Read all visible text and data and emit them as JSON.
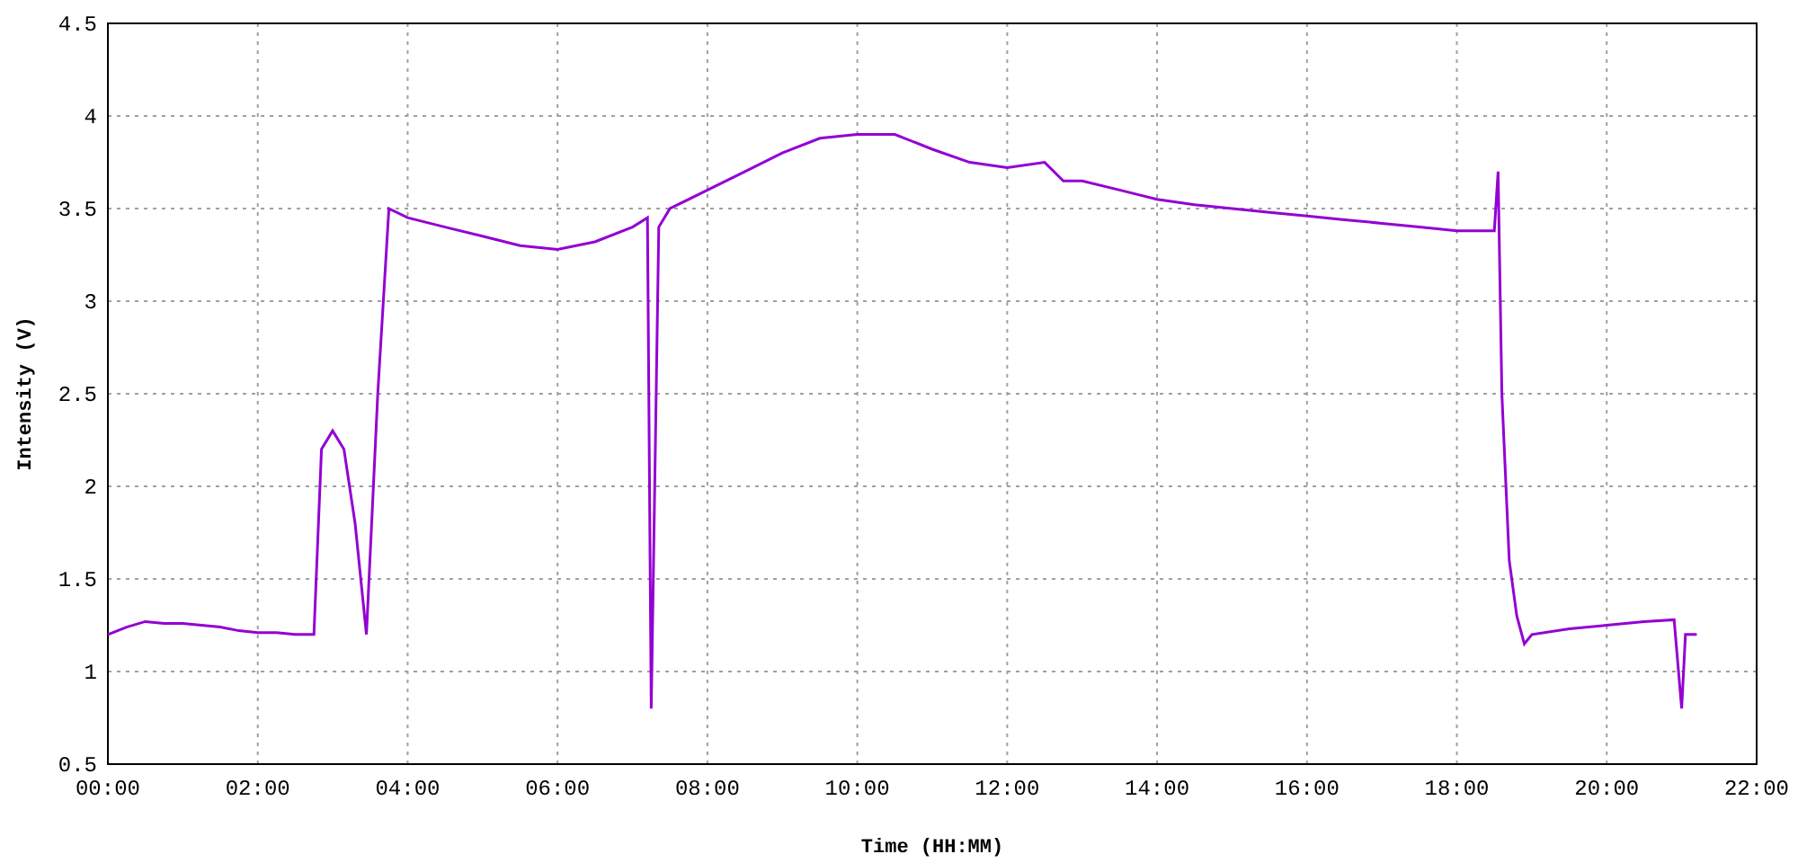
{
  "chart_data": {
    "type": "line",
    "xlabel": "Time (HH:MM)",
    "ylabel": "Intensity (V)",
    "grid": true,
    "xlim": [
      0,
      22
    ],
    "ylim": [
      0.5,
      4.5
    ],
    "xticks": [
      {
        "value": 0,
        "label": "00:00"
      },
      {
        "value": 2,
        "label": "02:00"
      },
      {
        "value": 4,
        "label": "04:00"
      },
      {
        "value": 6,
        "label": "06:00"
      },
      {
        "value": 8,
        "label": "08:00"
      },
      {
        "value": 10,
        "label": "10:00"
      },
      {
        "value": 12,
        "label": "12:00"
      },
      {
        "value": 14,
        "label": "14:00"
      },
      {
        "value": 16,
        "label": "16:00"
      },
      {
        "value": 18,
        "label": "18:00"
      },
      {
        "value": 20,
        "label": "20:00"
      },
      {
        "value": 22,
        "label": "22:00"
      }
    ],
    "yticks": [
      {
        "value": 0.5,
        "label": "0.5"
      },
      {
        "value": 1,
        "label": "1"
      },
      {
        "value": 1.5,
        "label": "1.5"
      },
      {
        "value": 2,
        "label": "2"
      },
      {
        "value": 2.5,
        "label": "2.5"
      },
      {
        "value": 3,
        "label": "3"
      },
      {
        "value": 3.5,
        "label": "3.5"
      },
      {
        "value": 4,
        "label": "4"
      },
      {
        "value": 4.5,
        "label": "4.5"
      }
    ],
    "x": [
      0,
      0.25,
      0.5,
      0.75,
      1,
      1.25,
      1.5,
      1.75,
      2,
      2.25,
      2.5,
      2.75,
      2.85,
      3,
      3.15,
      3.3,
      3.45,
      3.6,
      3.75,
      4,
      4.5,
      5,
      5.5,
      6,
      6.5,
      7,
      7.2,
      7.25,
      7.35,
      7.5,
      8,
      8.5,
      9,
      9.5,
      10,
      10.5,
      11,
      11.5,
      12,
      12.5,
      12.75,
      13,
      13.5,
      14,
      14.5,
      15,
      15.5,
      16,
      16.5,
      17,
      17.5,
      18,
      18.5,
      18.55,
      18.6,
      18.7,
      18.8,
      18.9,
      19,
      19.5,
      20,
      20.5,
      20.9,
      21,
      21.05,
      21.2
    ],
    "series": [
      {
        "color": "#9400d3",
        "values": [
          1.2,
          1.24,
          1.27,
          1.26,
          1.26,
          1.25,
          1.24,
          1.22,
          1.21,
          1.21,
          1.2,
          1.2,
          2.2,
          2.3,
          2.2,
          1.8,
          1.2,
          2.5,
          3.5,
          3.45,
          3.4,
          3.35,
          3.3,
          3.28,
          3.32,
          3.4,
          3.45,
          0.8,
          3.4,
          3.5,
          3.6,
          3.7,
          3.8,
          3.88,
          3.9,
          3.9,
          3.82,
          3.75,
          3.72,
          3.75,
          3.65,
          3.65,
          3.6,
          3.55,
          3.52,
          3.5,
          3.48,
          3.46,
          3.44,
          3.42,
          3.4,
          3.38,
          3.38,
          3.7,
          2.5,
          1.6,
          1.3,
          1.15,
          1.2,
          1.23,
          1.25,
          1.27,
          1.28,
          0.8,
          1.2,
          1.2
        ]
      }
    ]
  }
}
